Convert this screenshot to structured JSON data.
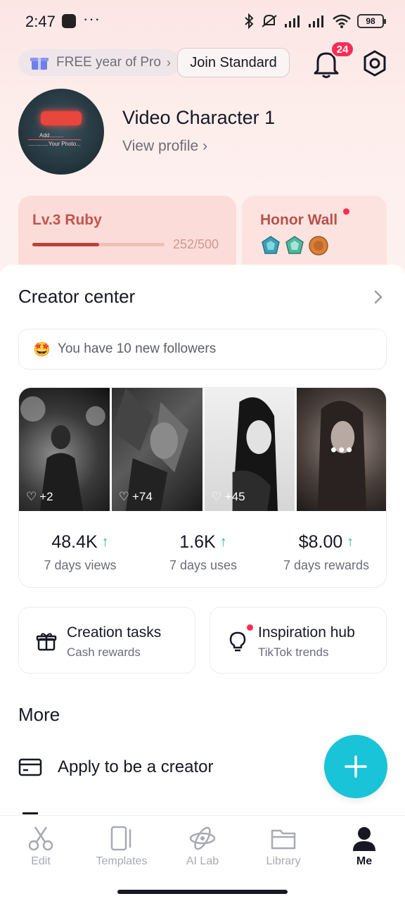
{
  "status_bar": {
    "time": "2:47",
    "overflow": "···",
    "battery": "98"
  },
  "header": {
    "promo_text": "FREE year of Pro",
    "join_label": "Join Standard",
    "notification_count": "24"
  },
  "profile": {
    "name": "Video Character 1",
    "view_profile": "View profile"
  },
  "level": {
    "title": "Lv.3 Ruby",
    "progress_text": "252/500",
    "progress_fraction": 0.504
  },
  "honor_wall": {
    "title": "Honor Wall",
    "gems": [
      "blue-gem-icon",
      "teal-gem-icon",
      "bronze-medal-icon"
    ]
  },
  "creator_center": {
    "title": "Creator center",
    "followers_text": "You have 10 new followers",
    "thumbnails": [
      {
        "likes": "+2"
      },
      {
        "likes": "+74"
      },
      {
        "likes": "+45"
      },
      {
        "likes": ""
      }
    ],
    "more_label": "•••",
    "stats": [
      {
        "value": "48.4K",
        "label": "7 days views"
      },
      {
        "value": "1.6K",
        "label": "7 days uses"
      },
      {
        "value": "$8.00",
        "label": "7 days rewards"
      }
    ]
  },
  "tasks": [
    {
      "title": "Creation tasks",
      "subtitle": "Cash rewards"
    },
    {
      "title": "Inspiration hub",
      "subtitle": "TikTok trends"
    }
  ],
  "more": {
    "title": "More",
    "apply_label": "Apply to be a creator"
  },
  "nav": {
    "items": [
      {
        "label": "Edit"
      },
      {
        "label": "Templates"
      },
      {
        "label": "AI Lab"
      },
      {
        "label": "Library"
      },
      {
        "label": "Me"
      }
    ]
  },
  "colors": {
    "accent_red": "#fe2c55",
    "fab_cyan": "#19c4d8",
    "up_green": "#1ec08a",
    "level_text": "#c1544d"
  }
}
